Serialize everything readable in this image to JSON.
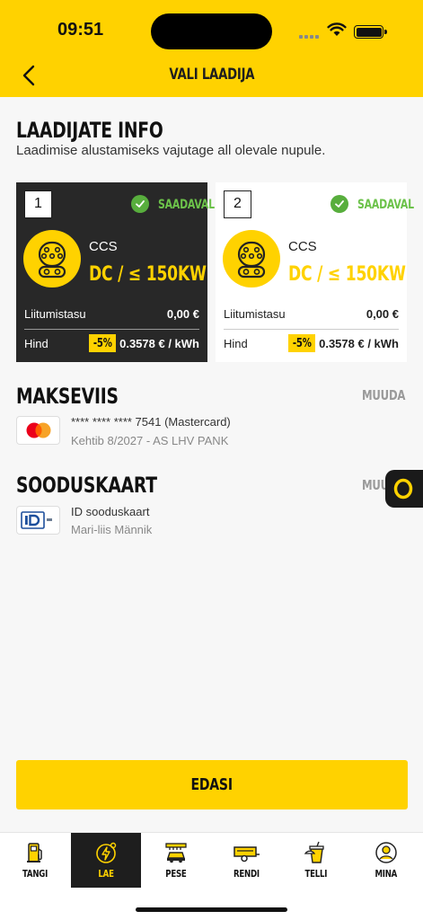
{
  "status": {
    "time": "09:51"
  },
  "header": {
    "title": "VALI LAADIJA"
  },
  "info": {
    "title": "LAADIJATE INFO",
    "subtitle": "Laadimise alustamiseks vajutage all olevale nupule."
  },
  "chargers": [
    {
      "number": "1",
      "status": "SAADAVAL",
      "plug_type": "CCS",
      "power": "DC / ≤ 150KW",
      "fee_label": "Liitumistasu",
      "fee_value": "0,00 €",
      "price_label": "Hind",
      "discount": "-5%",
      "price_value": "0.3578 € / kWh",
      "selected": true
    },
    {
      "number": "2",
      "status": "SAADAVAL",
      "plug_type": "CCS",
      "power": "DC / ≤ 150KW",
      "fee_label": "Liitumistasu",
      "fee_value": "0,00 €",
      "price_label": "Hind",
      "discount": "-5%",
      "price_value": "0.3578 € / kWh",
      "selected": false
    }
  ],
  "payment": {
    "title": "MAKSEVIIS",
    "change_label": "MUUDA",
    "card_line": "**** **** **** 7541 (Mastercard)",
    "expiry_line": "Kehtib 8/2027 - AS LHV PANK"
  },
  "discount_card": {
    "title": "SOODUSKAART",
    "change_label": "MUU",
    "name": "ID sooduskaart",
    "owner": "Mari-liis Männik"
  },
  "actions": {
    "next_label": "EDASI"
  },
  "nav": {
    "items": [
      {
        "label": "TANGI",
        "icon": "fuel-pump-icon"
      },
      {
        "label": "LAE",
        "icon": "charge-icon",
        "active": true
      },
      {
        "label": "PESE",
        "icon": "car-wash-icon"
      },
      {
        "label": "RENDI",
        "icon": "trailer-icon"
      },
      {
        "label": "TELLI",
        "icon": "food-icon"
      },
      {
        "label": "MINA",
        "icon": "profile-icon"
      }
    ]
  },
  "colors": {
    "brand_yellow": "#ffd200",
    "available_green": "#6cc24a",
    "dark_card": "#282828"
  }
}
